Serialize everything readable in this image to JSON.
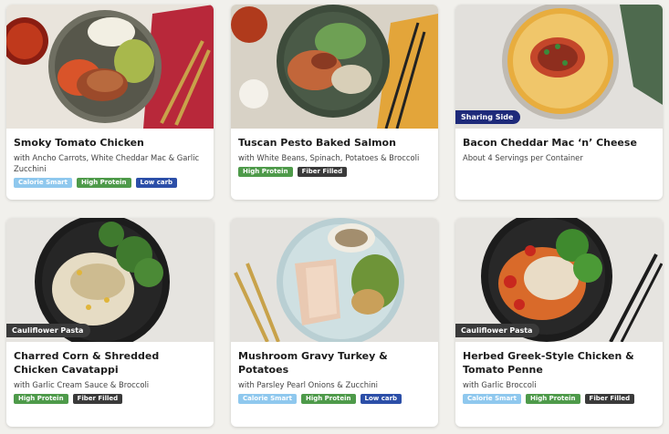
{
  "cards": [
    {
      "title": "Smoky Tomato Chicken",
      "subtitle": "with Ancho Carrots, White Cheddar Mac & Garlic Zucchini",
      "ribbon": "",
      "tags": [
        "Calorie Smart",
        "High Protein",
        "Low carb"
      ]
    },
    {
      "title": "Tuscan Pesto Baked Salmon",
      "subtitle": "with White Beans, Spinach, Potatoes & Broccoli",
      "ribbon": "",
      "tags": [
        "High Protein",
        "Fiber Filled"
      ]
    },
    {
      "title": "Bacon Cheddar Mac ‘n’ Cheese",
      "subtitle": "About 4 Servings per Container",
      "ribbon": "Sharing Side",
      "tags": []
    },
    {
      "title": "Charred Corn & Shredded Chicken Cavatappi",
      "subtitle": "with Garlic Cream Sauce & Broccoli",
      "ribbon": "Cauliflower Pasta",
      "tags": [
        "High Protein",
        "Fiber Filled"
      ]
    },
    {
      "title": "Mushroom Gravy Turkey & Potatoes",
      "subtitle": "with Parsley Pearl Onions & Zucchini",
      "ribbon": "",
      "tags": [
        "Calorie Smart",
        "High Protein",
        "Low carb"
      ]
    },
    {
      "title": "Herbed Greek-Style Chicken & Tomato Penne",
      "subtitle": "with Garlic Broccoli",
      "ribbon": "Cauliflower Pasta",
      "tags": [
        "Calorie Smart",
        "High Protein",
        "Fiber Filled"
      ]
    }
  ],
  "colors": {
    "calorie_smart": "#8fc8ee",
    "high_protein": "#4e9a4a",
    "low_carb": "#2c4fa8",
    "fiber_filled": "#3a3a3a",
    "sharing_side": "#1e2a7a",
    "cauliflower_pasta": "#3a3a3a"
  }
}
